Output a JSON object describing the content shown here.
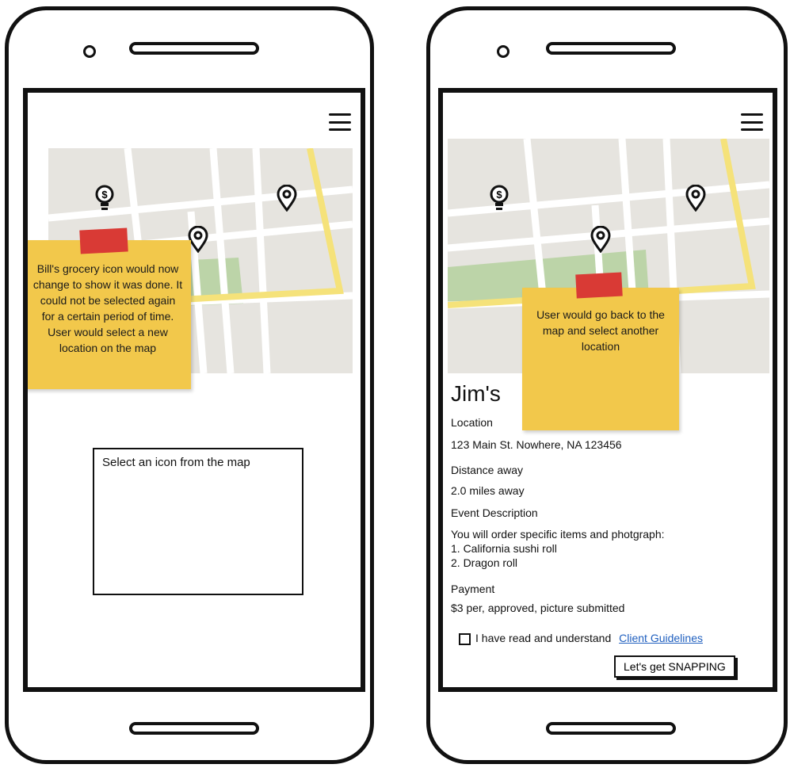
{
  "left_screen": {
    "sticky_note": "Bill's grocery icon would now change to show it was done. It could not be selected again for a certain period of time. User would select a new location on the map",
    "select_prompt": "Select an icon from the map"
  },
  "right_screen": {
    "sticky_note": "User would go back to the map and select another location",
    "place_name": "Jim's",
    "location_label": "Location",
    "location_value": "123 Main St. Nowhere, NA 123456",
    "distance_label": "Distance away",
    "distance_value": "2.0 miles away",
    "event_label": "Event Description",
    "event_lines": [
      "You will order specific items and photgraph:",
      "1. California sushi roll",
      "2. Dragon roll"
    ],
    "payment_label": "Payment",
    "payment_value": "$3 per, approved, picture submitted",
    "agreement_text": "I have read and understand",
    "guidelines_link": "Client Guidelines",
    "cta_label": "Let's get SNAPPING"
  },
  "icons": {
    "menu": "hamburger-menu-icon",
    "grocery": "dollar-lightbulb-icon",
    "pin": "map-pin-icon"
  },
  "colors": {
    "map_background": "#e6e4df",
    "road": "#ffffff",
    "highlight_road": "#f5e27a",
    "park": "#bcd4a8",
    "sticky_note": "#f2c84b",
    "tape": "#d93a35",
    "link": "#1f5fbf"
  }
}
